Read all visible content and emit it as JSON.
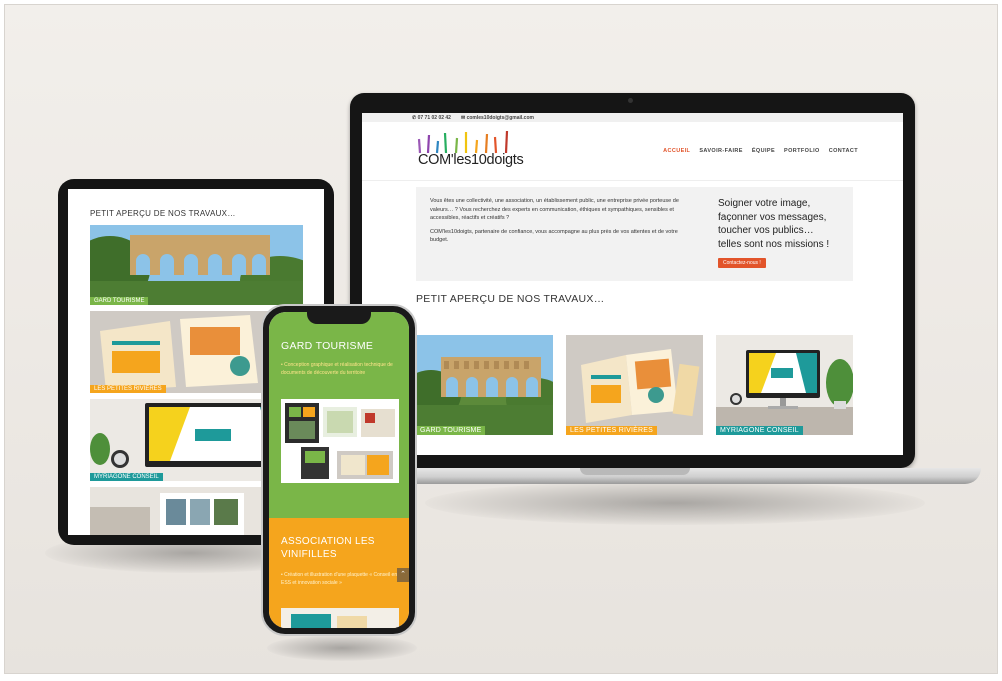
{
  "site": {
    "contact_phone": "07 71 02 02 42",
    "contact_email": "comles10doigts@gmail.com",
    "logo_text": "COM'les10doigts",
    "nav": [
      "ACCUEIL",
      "SAVOIR-FAIRE",
      "ÉQUIPE",
      "PORTFOLIO",
      "CONTACT"
    ],
    "intro_paragraph_1": "Vous êtes une collectivité, une association, un établissement public, une entreprise privée porteuse de valeurs… ? Vous recherchez des experts en communication, éthiques et sympathiques, sensibles et accessibles, réactifs et créatifs ?",
    "intro_paragraph_2": "COM'les10doigts, partenaire de confiance, vous accompagne au plus près de vos attentes et de votre budget.",
    "tagline": "Soigner votre image,\nfaçonner vos messages,\ntoucher vos publics…\ntelles sont nos missions !",
    "cta": "Contactez-nous !",
    "works_title": "PETIT APERÇU DE NOS TRAVAUX…",
    "works": [
      {
        "label": "GARD TOURISME",
        "color": "#7ab648"
      },
      {
        "label": "LES PETITES RIVIÈRES",
        "color": "#f5a51d"
      },
      {
        "label": "MYRIAGONE CONSEIL",
        "color": "#1e9a9a"
      }
    ]
  },
  "tablet": {
    "title": "PETIT APERÇU DE NOS TRAVAUX…",
    "labels": [
      "GARD TOURISME",
      "LES PETITES RIVIÈRES",
      "MYRIAGONE CONSEIL"
    ]
  },
  "phone": {
    "section1_title": "GARD TOURISME",
    "section1_desc": "• Conception graphique et réalisation technique de documents de découverte du territoire",
    "section2_title": "ASSOCIATION LES VINIFILLES",
    "section2_desc": "• Création et illustration d'une plaquette « Conseil en ESS et innovation sociale »",
    "scroll_icon": "chevron-up-icon"
  },
  "colors": {
    "accent": "#e2542a",
    "green": "#7ab648",
    "orange": "#f5a51d",
    "teal": "#1e9a9a"
  }
}
